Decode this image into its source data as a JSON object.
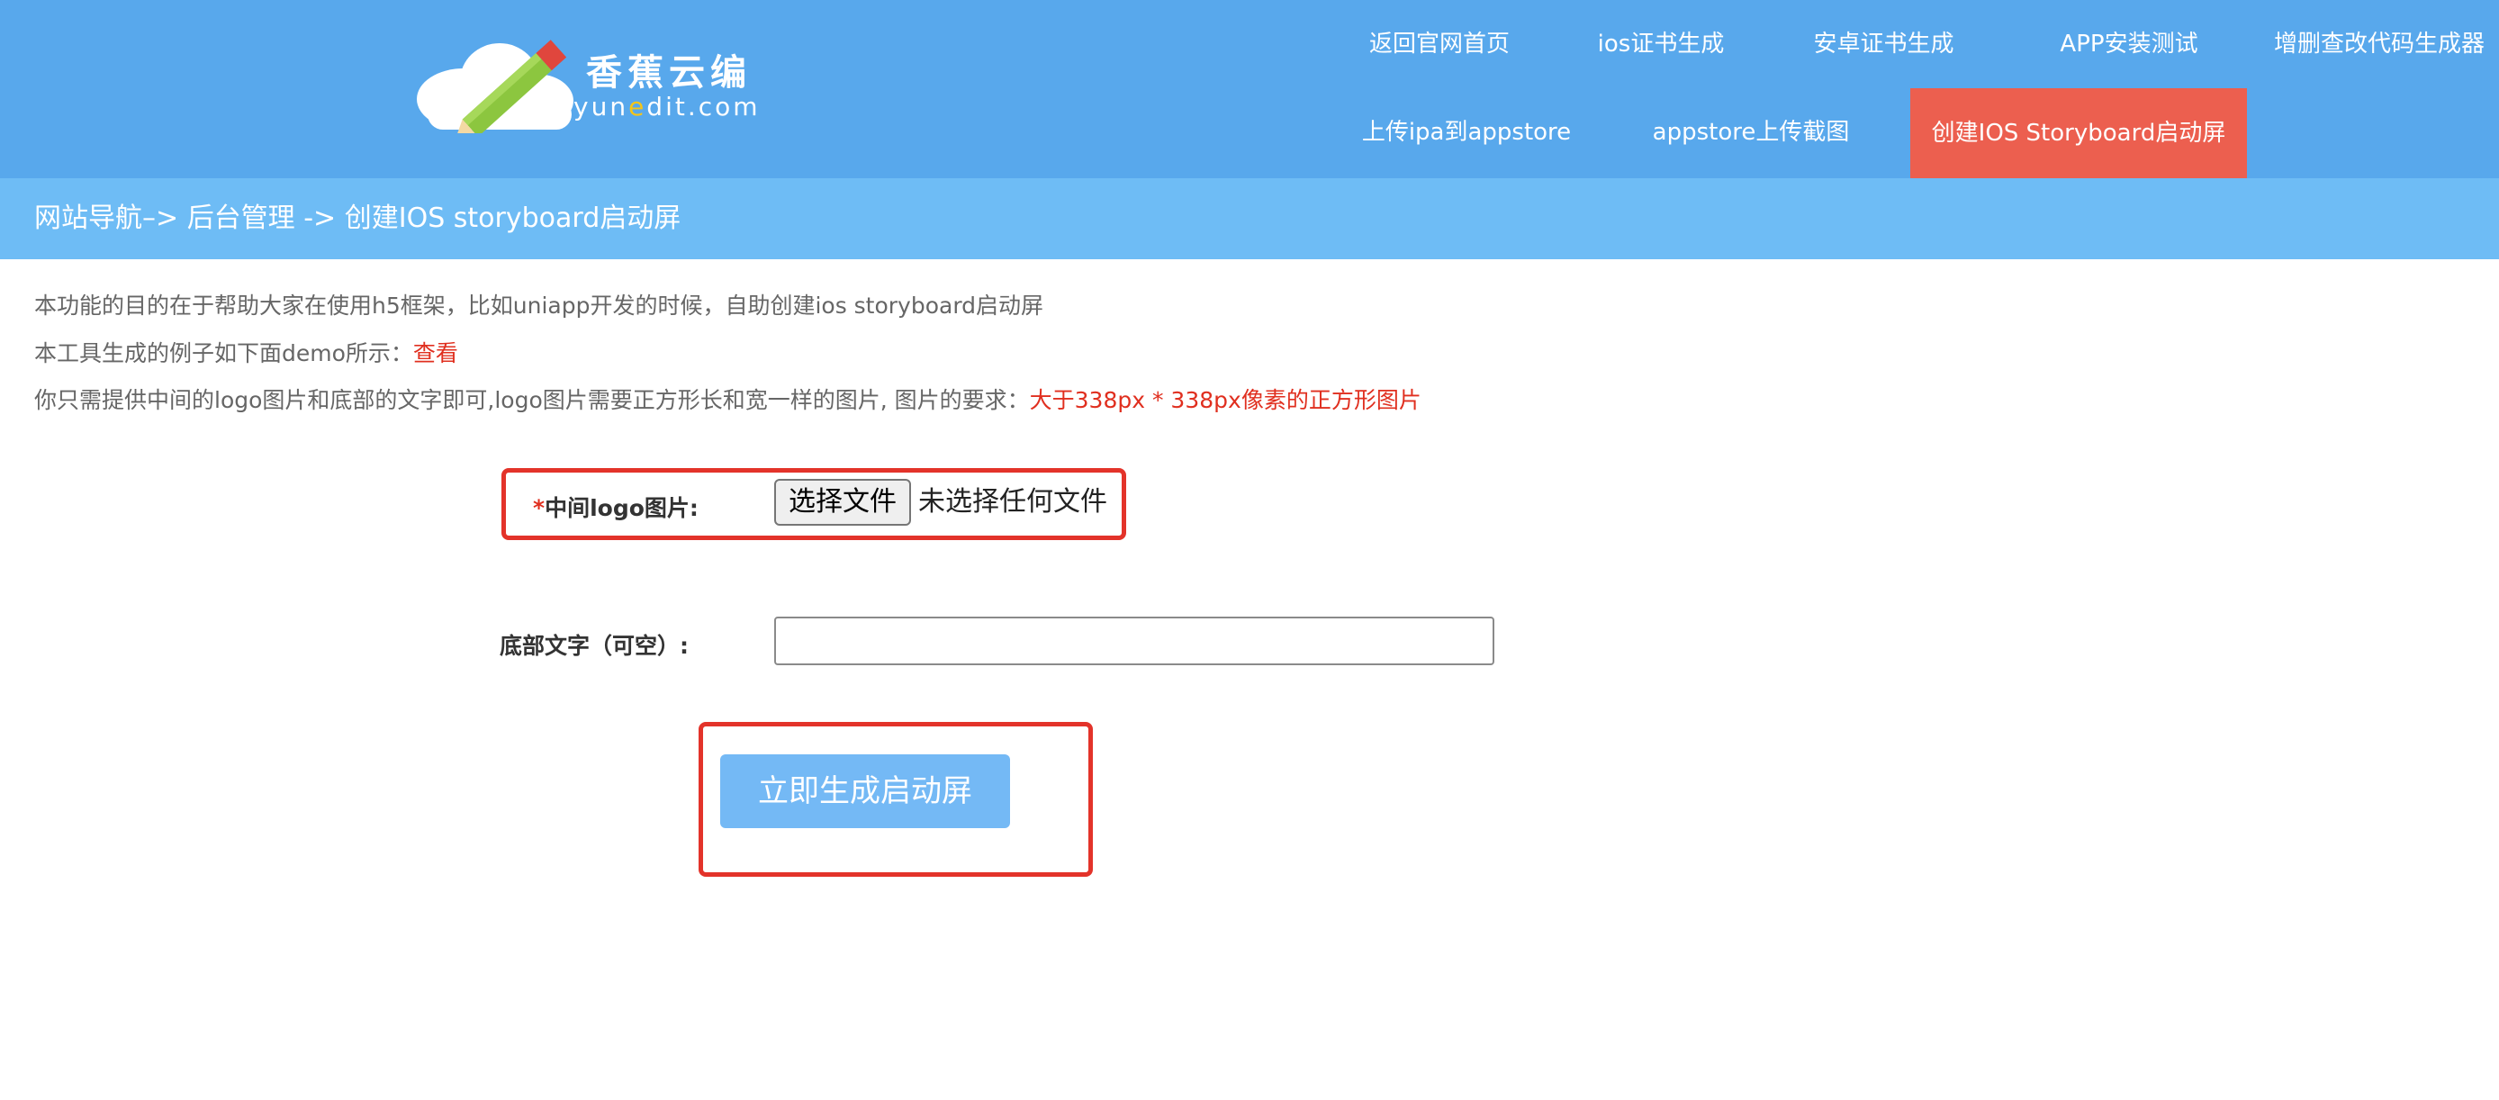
{
  "brand": {
    "name_cn": "香蕉云编",
    "domain_prefix": "yun",
    "domain_highlight": "e",
    "domain_suffix": "dit.com"
  },
  "nav": {
    "row1": [
      "返回官网首页",
      "ios证书生成",
      "安卓证书生成",
      "APP安装测试",
      "增删查改代码生成器"
    ],
    "row2": [
      "上传ipa到appstore",
      "appstore上传截图",
      "创建IOS Storyboard启动屏"
    ],
    "active": "创建IOS Storyboard启动屏"
  },
  "breadcrumb": {
    "root": "网站导航",
    "sep": "–>",
    "admin": "后台管理",
    "sep2": "->",
    "current": "创建IOS storyboard启动屏"
  },
  "intro": {
    "line1": "本功能的目的在于帮助大家在使用h5框架，比如uniapp开发的时候，自助创建ios storyboard启动屏",
    "line2_prefix": "本工具生成的例子如下面demo所示：",
    "line2_link": "查看",
    "line3_prefix": "你只需提供中间的logo图片和底部的文字即可,logo图片需要正方形长和宽一样的图片, 图片的要求：",
    "line3_highlight": "大于338px * 338px像素的正方形图片"
  },
  "form": {
    "required_mark": "*",
    "logo_label": "中间logo图片:",
    "file_button": "选择文件",
    "file_status": "未选择任何文件",
    "bottom_text_label": "底部文字（可空）:",
    "bottom_text_value": "",
    "submit_label": "立即生成启动屏"
  },
  "colors": {
    "header_bg": "#58a8ec",
    "breadcrumb_bg": "#6ebcf5",
    "active_nav_bg": "#ec5f4f",
    "highlight_red": "#e02f1f",
    "submit_bg": "#74b9f5"
  }
}
